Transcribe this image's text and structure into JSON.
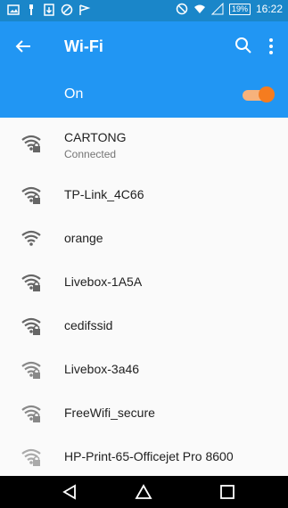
{
  "status_bar": {
    "left_icons": [
      "image-icon",
      "usb-icon",
      "download-icon",
      "blocked-icon",
      "flag-icon"
    ],
    "battery": "19%",
    "time": "16:22"
  },
  "app_bar": {
    "title": "Wi-Fi",
    "back_icon": "arrow-left-icon",
    "search_icon": "search-icon",
    "menu_icon": "more-vert-icon"
  },
  "wifi_toggle": {
    "label": "On",
    "enabled": true
  },
  "networks": [
    {
      "ssid": "CARTONG",
      "status": "Connected",
      "secured": true
    },
    {
      "ssid": "TP-Link_4C66",
      "status": "",
      "secured": true
    },
    {
      "ssid": "orange",
      "status": "",
      "secured": false
    },
    {
      "ssid": "Livebox-1A5A",
      "status": "",
      "secured": true
    },
    {
      "ssid": "cedifssid",
      "status": "",
      "secured": true
    },
    {
      "ssid": "Livebox-3a46",
      "status": "",
      "secured": true
    },
    {
      "ssid": "FreeWifi_secure",
      "status": "",
      "secured": true
    },
    {
      "ssid": "HP-Print-65-Officejet Pro 8600",
      "status": "",
      "secured": true
    }
  ],
  "nav_bar": {
    "back": "triangle-back-icon",
    "home": "home-icon",
    "recents": "recents-icon"
  },
  "colors": {
    "statusbar": "#1a86c9",
    "appbar": "#2196f3",
    "toggle_thumb": "#f57c1f",
    "toggle_track": "#f6b27c"
  }
}
